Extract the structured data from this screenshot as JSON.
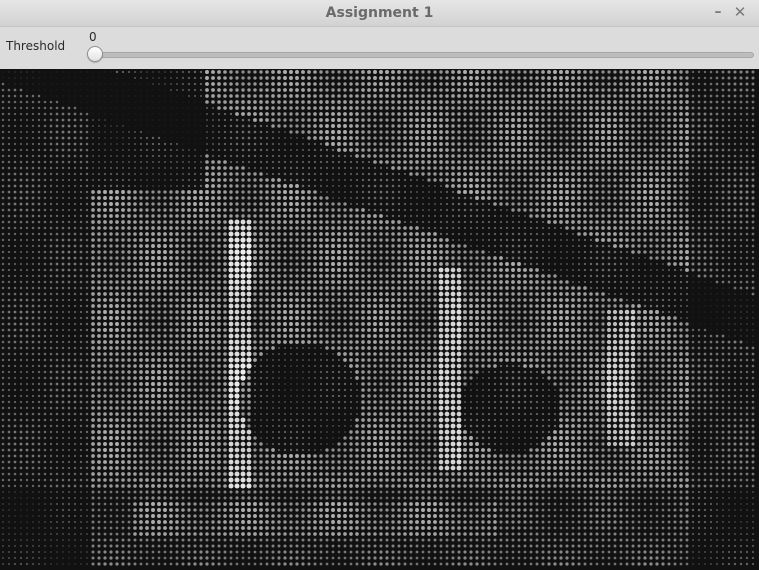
{
  "window": {
    "title": "Assignment 1",
    "minimize_glyph": "–",
    "close_glyph": "✕"
  },
  "toolbar": {
    "threshold_label": "Threshold",
    "threshold_value": "0",
    "threshold_fraction": 0
  },
  "colors": {
    "titlebar": "#d9d9d9",
    "toolbar": "#dcdcdc",
    "image_background": "#111111",
    "dot_light": "#f0f0f0"
  },
  "icons": {
    "minimize": "minimize-icon",
    "close": "close-icon"
  }
}
